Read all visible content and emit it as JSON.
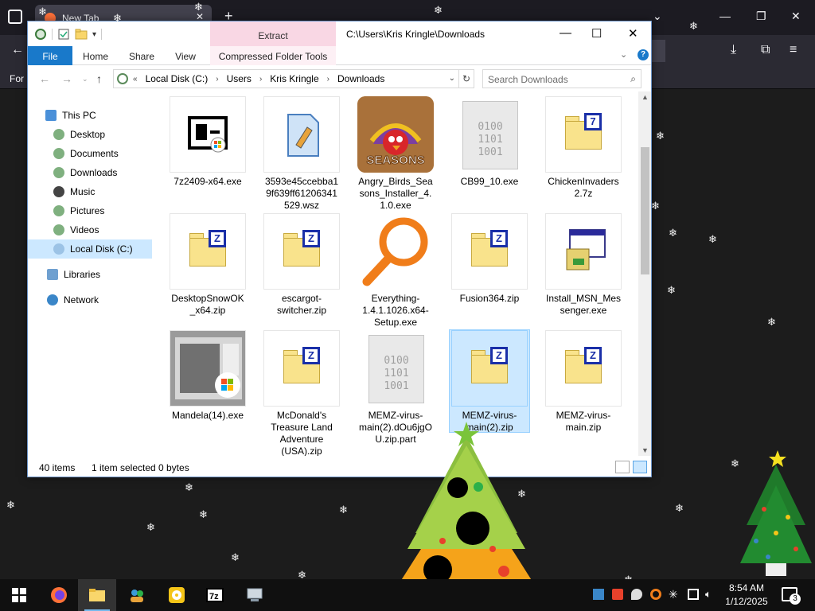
{
  "browser": {
    "tab_title": "New Tab",
    "bookmark_text": "For"
  },
  "explorer": {
    "title": "C:\\Users\\Kris Kringle\\Downloads",
    "contextual_tab": "Extract",
    "ribbon_tabs": [
      "File",
      "Home",
      "Share",
      "View",
      "Compressed Folder Tools"
    ],
    "breadcrumb": [
      "Local Disk (C:)",
      "Users",
      "Kris Kringle",
      "Downloads"
    ],
    "search_placeholder": "Search Downloads",
    "nav_items": [
      {
        "label": "This PC",
        "icon": "pc-icon"
      },
      {
        "label": "Desktop",
        "icon": "desktop-icon"
      },
      {
        "label": "Documents",
        "icon": "documents-icon"
      },
      {
        "label": "Downloads",
        "icon": "downloads-icon"
      },
      {
        "label": "Music",
        "icon": "music-icon"
      },
      {
        "label": "Pictures",
        "icon": "pictures-icon"
      },
      {
        "label": "Videos",
        "icon": "videos-icon"
      },
      {
        "label": "Local Disk (C:)",
        "icon": "disk-icon"
      },
      {
        "label": "Libraries",
        "icon": "libraries-icon"
      },
      {
        "label": "Network",
        "icon": "network-icon"
      }
    ],
    "files": [
      {
        "name": "7z2409-x64.exe",
        "kind": "7z-exe"
      },
      {
        "name": "3593e45ccebba19f639ff61206341529.wsz",
        "kind": "wsz"
      },
      {
        "name": "Angry_Birds_Seasons_Installer_4.1.0.exe",
        "kind": "angry-birds",
        "badge": "SEASONS"
      },
      {
        "name": "CB99_10.exe",
        "kind": "binary"
      },
      {
        "name": "ChickenInvaders2.7z",
        "kind": "7z"
      },
      {
        "name": "DesktopSnowOK_x64.zip",
        "kind": "zip"
      },
      {
        "name": "escargot-switcher.zip",
        "kind": "zip"
      },
      {
        "name": "Everything-1.4.1.1026.x64-Setup.exe",
        "kind": "everything"
      },
      {
        "name": "Fusion364.zip",
        "kind": "zip"
      },
      {
        "name": "Install_MSN_Messenger.exe",
        "kind": "installer"
      },
      {
        "name": "Mandela(14).exe",
        "kind": "mandela"
      },
      {
        "name": "McDonald's Treasure Land Adventure (USA).zip",
        "kind": "zip"
      },
      {
        "name": "MEMZ-virus-main(2).dOu6jgOU.zip.part",
        "kind": "binary"
      },
      {
        "name": "MEMZ-virus-main(2).zip",
        "kind": "zip",
        "selected": true
      },
      {
        "name": "MEMZ-virus-main.zip",
        "kind": "zip"
      }
    ],
    "status": {
      "count": "40 items",
      "selected": "1 item selected",
      "size": "0 bytes"
    }
  },
  "taskbar": {
    "time": "8:54 AM",
    "date": "1/12/2025",
    "notifications": "3"
  },
  "colors": {
    "accent": "#1979ca",
    "selection": "#cce8ff",
    "contextual": "#f9d7e4"
  }
}
